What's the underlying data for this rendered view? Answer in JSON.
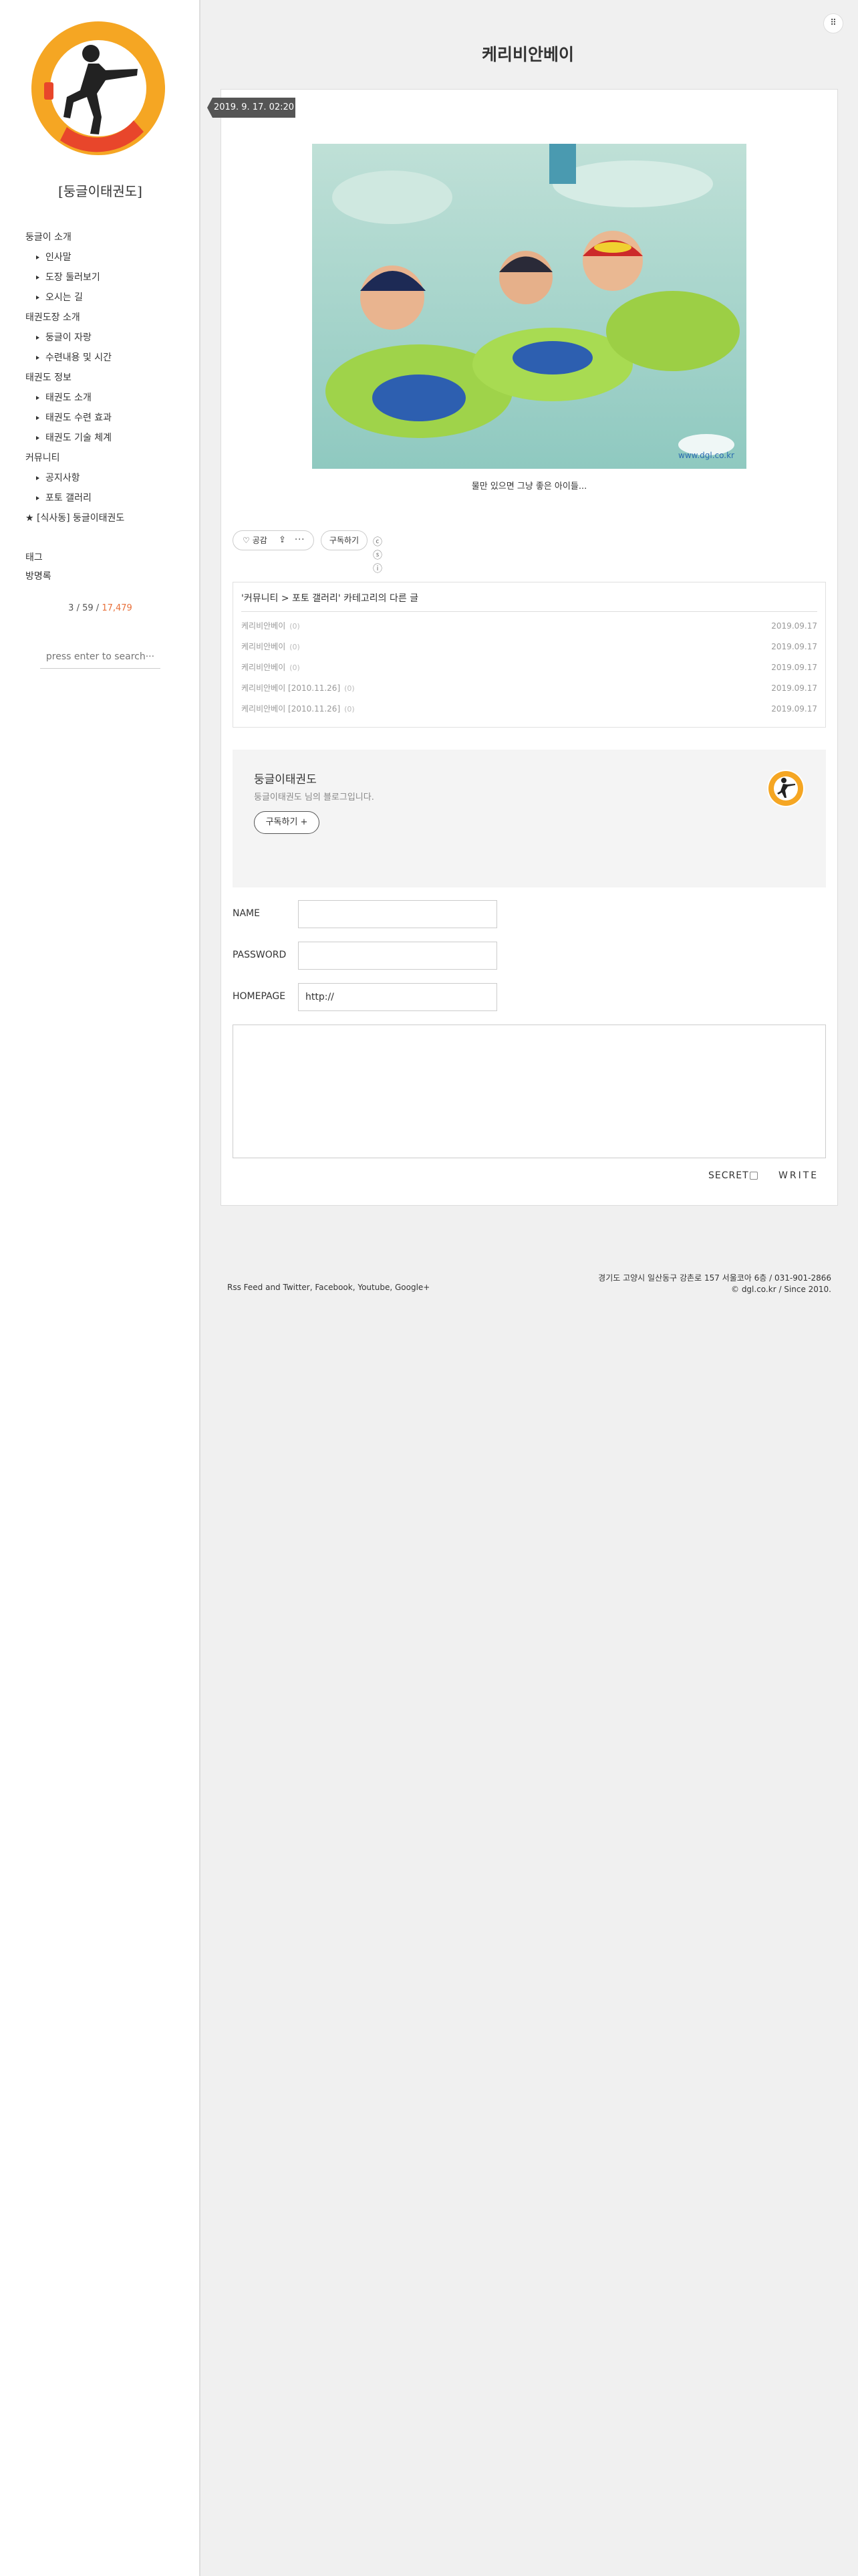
{
  "sidebar": {
    "blog_name": "[둥글이태권도]",
    "menu": [
      {
        "label": "둥글이 소개",
        "sub": false
      },
      {
        "label": "인사말",
        "sub": true
      },
      {
        "label": "도장 둘러보기",
        "sub": true
      },
      {
        "label": "오시는 길",
        "sub": true
      },
      {
        "label": "태권도장 소개",
        "sub": false
      },
      {
        "label": "둥글이 자랑",
        "sub": true
      },
      {
        "label": "수련내용 및 시간",
        "sub": true
      },
      {
        "label": "태권도 정보",
        "sub": false
      },
      {
        "label": "태권도 소개",
        "sub": true
      },
      {
        "label": "태권도 수련 효과",
        "sub": true
      },
      {
        "label": "태권도 기술 체계",
        "sub": true
      },
      {
        "label": "커뮤니티",
        "sub": false
      },
      {
        "label": "공지사항",
        "sub": true
      },
      {
        "label": "포토 갤러리",
        "sub": true
      },
      {
        "label": "★ [식사동] 둥글이태권도",
        "sub": false
      }
    ],
    "links": {
      "tag": "태그",
      "guestbook": "방명록"
    },
    "counter": {
      "today": "3",
      "yesterday": "59",
      "total": "17,479",
      "sep": " / "
    },
    "search_placeholder": "press enter to search···"
  },
  "top_icon": "⠿",
  "post": {
    "title": "케리비안베이",
    "date": "2019. 9. 17. 02:20",
    "caption": "물만 있으면 그냥 좋은 아이들...",
    "watermark": "www.dgl.co.kr",
    "like_label": "공감",
    "subscribe_label": "구독하기",
    "cc_icons": "ⓒ ⓢ ⓘ"
  },
  "related": {
    "title": "'커뮤니티 > 포토 갤러리' 카테고리의 다른 글",
    "items": [
      {
        "title": "케리비안베이",
        "count": "(0)",
        "date": "2019.09.17"
      },
      {
        "title": "케리비안베이",
        "count": "(0)",
        "date": "2019.09.17"
      },
      {
        "title": "케리비안베이",
        "count": "(0)",
        "date": "2019.09.17"
      },
      {
        "title": "케리비안베이 [2010.11.26]",
        "count": "(0)",
        "date": "2019.09.17"
      },
      {
        "title": "케리비안베이 [2010.11.26]",
        "count": "(0)",
        "date": "2019.09.17"
      }
    ]
  },
  "profile": {
    "name": "둥글이태권도",
    "desc": "둥글이태권도 님의 블로그입니다.",
    "button": "구독하기 +"
  },
  "comment_form": {
    "name_label": "NAME",
    "password_label": "PASSWORD",
    "homepage_label": "HOMEPAGE",
    "homepage_value": "http://",
    "secret_label": "SECRET",
    "write_label": "WRITE"
  },
  "footer": {
    "left": "Rss Feed and Twitter, Facebook, Youtube, Google+",
    "address": "경기도 고양시 일산동구 강촌로 157 서울코아 6층 / 031-901-2866",
    "copyright": "© dgl.co.kr / Since 2010."
  }
}
